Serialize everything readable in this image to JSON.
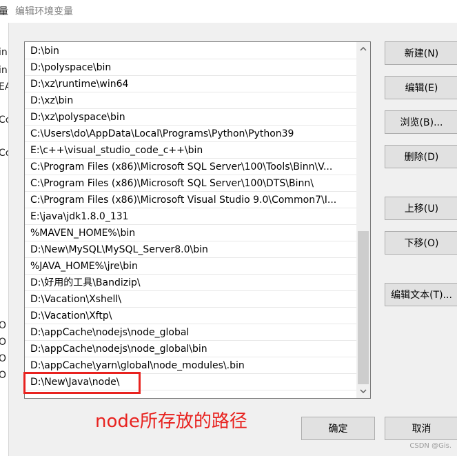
{
  "window": {
    "title": "编辑环境变量"
  },
  "path_entries": [
    "D:\\bin",
    "D:\\polyspace\\bin",
    "D:\\xz\\runtime\\win64",
    "D:\\xz\\bin",
    "D:\\xz\\polyspace\\bin",
    "C:\\Users\\do\\AppData\\Local\\Programs\\Python\\Python39",
    "E:\\c++\\visual_studio_code_c++\\bin",
    "C:\\Program Files (x86)\\Microsoft SQL Server\\100\\Tools\\Binn\\V...",
    "C:\\Program Files (x86)\\Microsoft SQL Server\\100\\DTS\\Binn\\",
    "C:\\Program Files (x86)\\Microsoft Visual Studio 9.0\\Common7\\I...",
    "E:\\java\\jdk1.8.0_131",
    "%MAVEN_HOME%\\bin",
    "D:\\New\\MySQL\\MySQL_Server8.0\\bin",
    "%JAVA_HOME%\\jre\\bin",
    "D:\\好用的工具\\Bandizip\\",
    "D:\\Vacation\\Xshell\\",
    "D:\\Vacation\\Xftp\\",
    "D:\\appCache\\nodejs\\node_global",
    "D:\\appCache\\nodejs\\node_global\\bin",
    "D:\\appCache\\yarn\\global\\node_modules\\.bin",
    "D:\\New\\Java\\node\\"
  ],
  "buttons": {
    "new": "新建(N)",
    "edit": "编辑(E)",
    "browse": "浏览(B)...",
    "delete": "删除(D)",
    "move_up": "上移(U)",
    "move_down": "下移(O)",
    "edit_text": "编辑文本(T)...",
    "ok": "确定",
    "cancel": "取消"
  },
  "annotation": "node所存放的路径",
  "watermark": "CSDN @Gis.",
  "left_strip_fragments": [
    "量",
    "in",
    "in",
    "EA",
    "Cc",
    "Cc",
    "O",
    "O",
    "O",
    "O"
  ]
}
